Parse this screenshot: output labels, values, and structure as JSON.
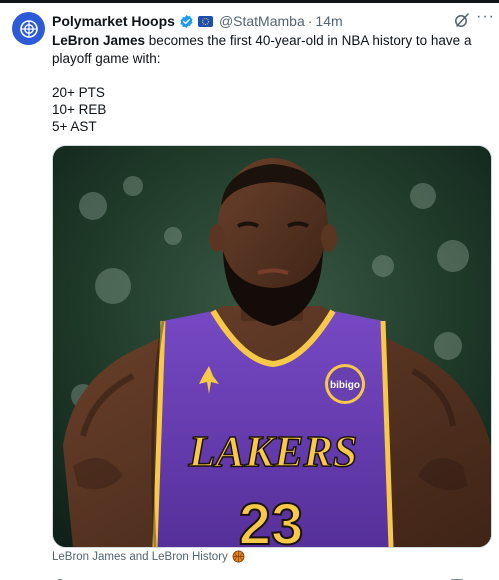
{
  "tweet": {
    "author_name": "Polymarket Hoops",
    "handle": "@StatMamba",
    "separator": "·",
    "time": "14m",
    "text_highlight": "LeBron James",
    "text_rest": " becomes the first 40-year-old in NBA history to have a playoff game with:",
    "stats": [
      "20+ PTS",
      "10+ REB",
      "5+ AST"
    ],
    "more_label": "···"
  },
  "media": {
    "jersey_wordmark": "LAKERS",
    "jersey_number": "23",
    "sponsor_patch": "bibigo",
    "caption": "LeBron James and LeBron History"
  },
  "colors": {
    "accent_blue": "#1d9bf0",
    "jersey_purple": "#6a3fb0",
    "jersey_gold": "#f7c948",
    "secondary_text": "#536471"
  },
  "icons": {
    "avatar": "polymarket-logo-icon",
    "verified": "verified-badge-icon",
    "flag": "flag-icon",
    "grok": "grok-icon",
    "more": "more-icon",
    "basketball": "basketball-icon"
  }
}
